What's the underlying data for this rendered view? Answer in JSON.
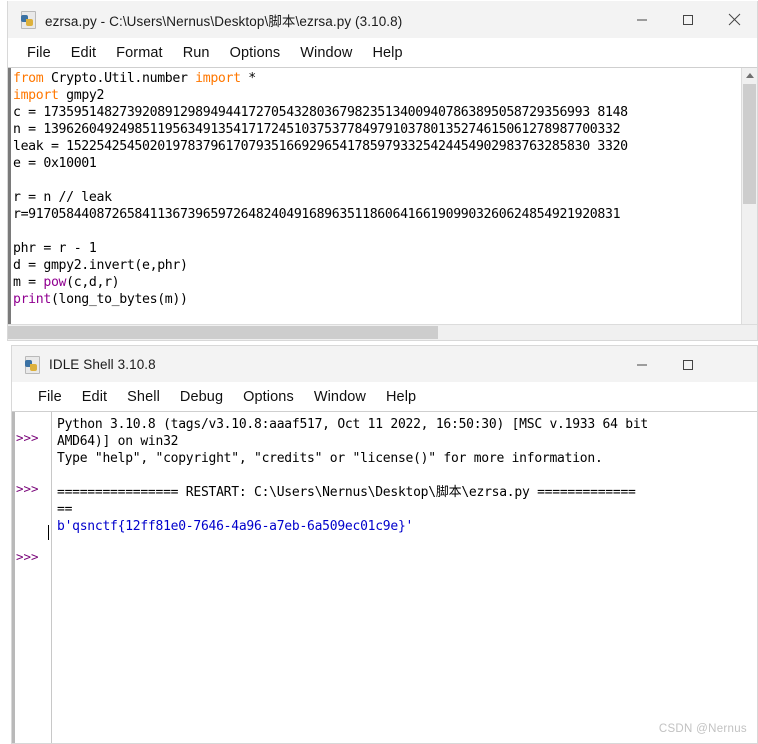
{
  "editor": {
    "title": "ezrsa.py - C:\\Users\\Nernus\\Desktop\\脚本\\ezrsa.py (3.10.8)",
    "icon": "python-file-icon",
    "caption": {
      "minimize": "minimize-icon",
      "maximize": "maximize-icon",
      "close": "close-icon"
    },
    "menu": [
      "File",
      "Edit",
      "Format",
      "Run",
      "Options",
      "Window",
      "Help"
    ],
    "code_lines": [
      {
        "segments": [
          {
            "t": "from",
            "c": "kw"
          },
          {
            "t": " Crypto.Util.number ",
            "c": ""
          },
          {
            "t": "import",
            "c": "kw"
          },
          {
            "t": " *",
            "c": ""
          }
        ]
      },
      {
        "segments": [
          {
            "t": "import",
            "c": "kw"
          },
          {
            "t": " gmpy2",
            "c": ""
          }
        ]
      },
      {
        "segments": [
          {
            "t": "c = 173595148273920891298949441727054328036798235134009407863895058729356993 8148",
            "c": ""
          }
        ]
      },
      {
        "segments": [
          {
            "t": "n = 1396260492498511956349135417172451037537784979103780135274615061278987700332",
            "c": ""
          }
        ]
      },
      {
        "segments": [
          {
            "t": "leak = 152254254502019783796170793516692965417859793325424454902983763285830 3320",
            "c": ""
          }
        ]
      },
      {
        "segments": [
          {
            "t": "e = 0x10001",
            "c": ""
          }
        ]
      },
      {
        "segments": [
          {
            "t": "",
            "c": ""
          }
        ]
      },
      {
        "segments": [
          {
            "t": "r = n // leak",
            "c": ""
          }
        ]
      },
      {
        "segments": [
          {
            "t": "r=917058440872658411367396597264824049168963511860641661909903260624854921920831",
            "c": ""
          }
        ]
      },
      {
        "segments": [
          {
            "t": "",
            "c": ""
          }
        ]
      },
      {
        "segments": [
          {
            "t": "phr = r - 1",
            "c": ""
          }
        ]
      },
      {
        "segments": [
          {
            "t": "d = gmpy2.invert(e,phr)",
            "c": ""
          }
        ]
      },
      {
        "segments": [
          {
            "t": "m = ",
            "c": ""
          },
          {
            "t": "pow",
            "c": "bi"
          },
          {
            "t": "(c,d,r)",
            "c": ""
          }
        ]
      },
      {
        "segments": [
          {
            "t": "print",
            "c": "bi"
          },
          {
            "t": "(long_to_bytes(m))",
            "c": ""
          }
        ]
      }
    ],
    "scrollbar": {
      "up_arrow": "scroll-up-arrow-icon",
      "down_arrow": "scroll-down-arrow-icon"
    }
  },
  "shell": {
    "title": "IDLE Shell 3.10.8",
    "icon": "python-file-icon",
    "caption": {
      "minimize": "minimize-icon",
      "maximize": "maximize-icon"
    },
    "menu": [
      "File",
      "Edit",
      "Shell",
      "Debug",
      "Options",
      "Window",
      "Help"
    ],
    "prompts": ">>>\n\n\n>>>\n\n\n\n>>>",
    "output_lines": [
      {
        "segments": [
          {
            "t": "Python 3.10.8 (tags/v3.10.8:aaaf517, Oct 11 2022, 16:50:30) [MSC v.1933 64 bit",
            "c": ""
          }
        ]
      },
      {
        "segments": [
          {
            "t": "AMD64)] on win32",
            "c": ""
          }
        ]
      },
      {
        "segments": [
          {
            "t": "Type \"help\", \"copyright\", \"credits\" or \"license()\" for more information.",
            "c": ""
          }
        ]
      },
      {
        "segments": [
          {
            "t": "",
            "c": ""
          }
        ]
      },
      {
        "segments": [
          {
            "t": "================ RESTART: C:\\Users\\Nernus\\Desktop\\脚本\\ezrsa.py =============",
            "c": ""
          }
        ]
      },
      {
        "segments": [
          {
            "t": "==",
            "c": ""
          }
        ]
      },
      {
        "segments": [
          {
            "t": "b'qsnctf{12ff81e0-7646-4a96-a7eb-6a509ec01c9e}'",
            "c": "blue"
          }
        ]
      }
    ]
  },
  "watermark": "CSDN @Nernus",
  "colors": {
    "keyword": "#ff7700",
    "builtin": "#900090",
    "string_output": "#0000cc",
    "prompt": "#770077",
    "titlebar_bg": "#f3f3f3"
  }
}
